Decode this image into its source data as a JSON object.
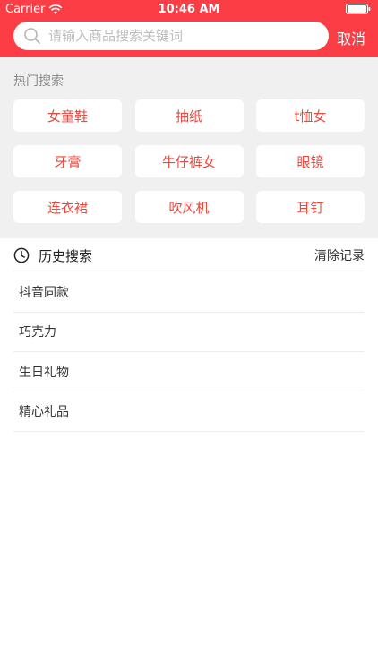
{
  "status_bar": {
    "carrier": "Carrier",
    "time": "10:46 AM"
  },
  "search": {
    "placeholder": "请输入商品搜索关键词",
    "value": "",
    "cancel_label": "取消"
  },
  "hot_search": {
    "title": "热门搜索",
    "tags": [
      "女童鞋",
      "抽纸",
      "t恤女",
      "牙膏",
      "牛仔裤女",
      "眼镜",
      "连衣裙",
      "吹风机",
      "耳钉"
    ]
  },
  "history": {
    "title": "历史搜索",
    "clear_label": "清除记录",
    "items": [
      "抖音同款",
      "巧克力",
      "生日礼物",
      "精心礼品"
    ]
  },
  "colors": {
    "brand_red": "#fb3e45",
    "tag_text": "#e94a3f"
  }
}
